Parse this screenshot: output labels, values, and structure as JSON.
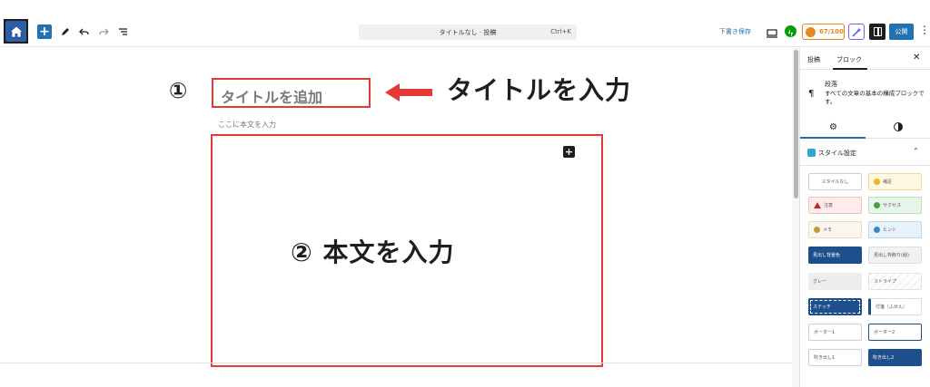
{
  "topbar": {
    "document_title": "タイトルなし · 投稿",
    "shortcut": "Ctrl+K",
    "draft_save": "下書き保存",
    "score": "67/100",
    "publish": "公開",
    "colors": {
      "accent": "#2271b1",
      "score": "#e8871e",
      "jetpack": "#069e08"
    }
  },
  "editor": {
    "num1": "①",
    "title_placeholder": "タイトルを追加",
    "arrow_label": "タイトルを入力",
    "body_placeholder": "ここに本文を入力",
    "body_label": "② 本文を入力",
    "highlight_color": "#e53935"
  },
  "sidebar": {
    "tab_post": "投稿",
    "tab_block": "ブロック",
    "block_name": "段落",
    "block_desc": "すべての文章の基本の構成ブロックです。",
    "section_title": "スタイル設定",
    "styles": [
      {
        "label": "スタイルなし"
      },
      {
        "label": "補足"
      },
      {
        "label": "注意"
      },
      {
        "label": "サクセス"
      },
      {
        "label": "メモ"
      },
      {
        "label": "ヒント"
      },
      {
        "label": "見出し背景色"
      },
      {
        "label": "見出し枠飾り(緑)"
      },
      {
        "label": "グレー"
      },
      {
        "label": "ストライプ"
      },
      {
        "label": "ステッチ"
      },
      {
        "label": "付箋（ふせん）"
      },
      {
        "label": "ボーダー1"
      },
      {
        "label": "ボーダー2"
      },
      {
        "label": "吹き出し1"
      },
      {
        "label": "吹き出し2"
      }
    ]
  }
}
